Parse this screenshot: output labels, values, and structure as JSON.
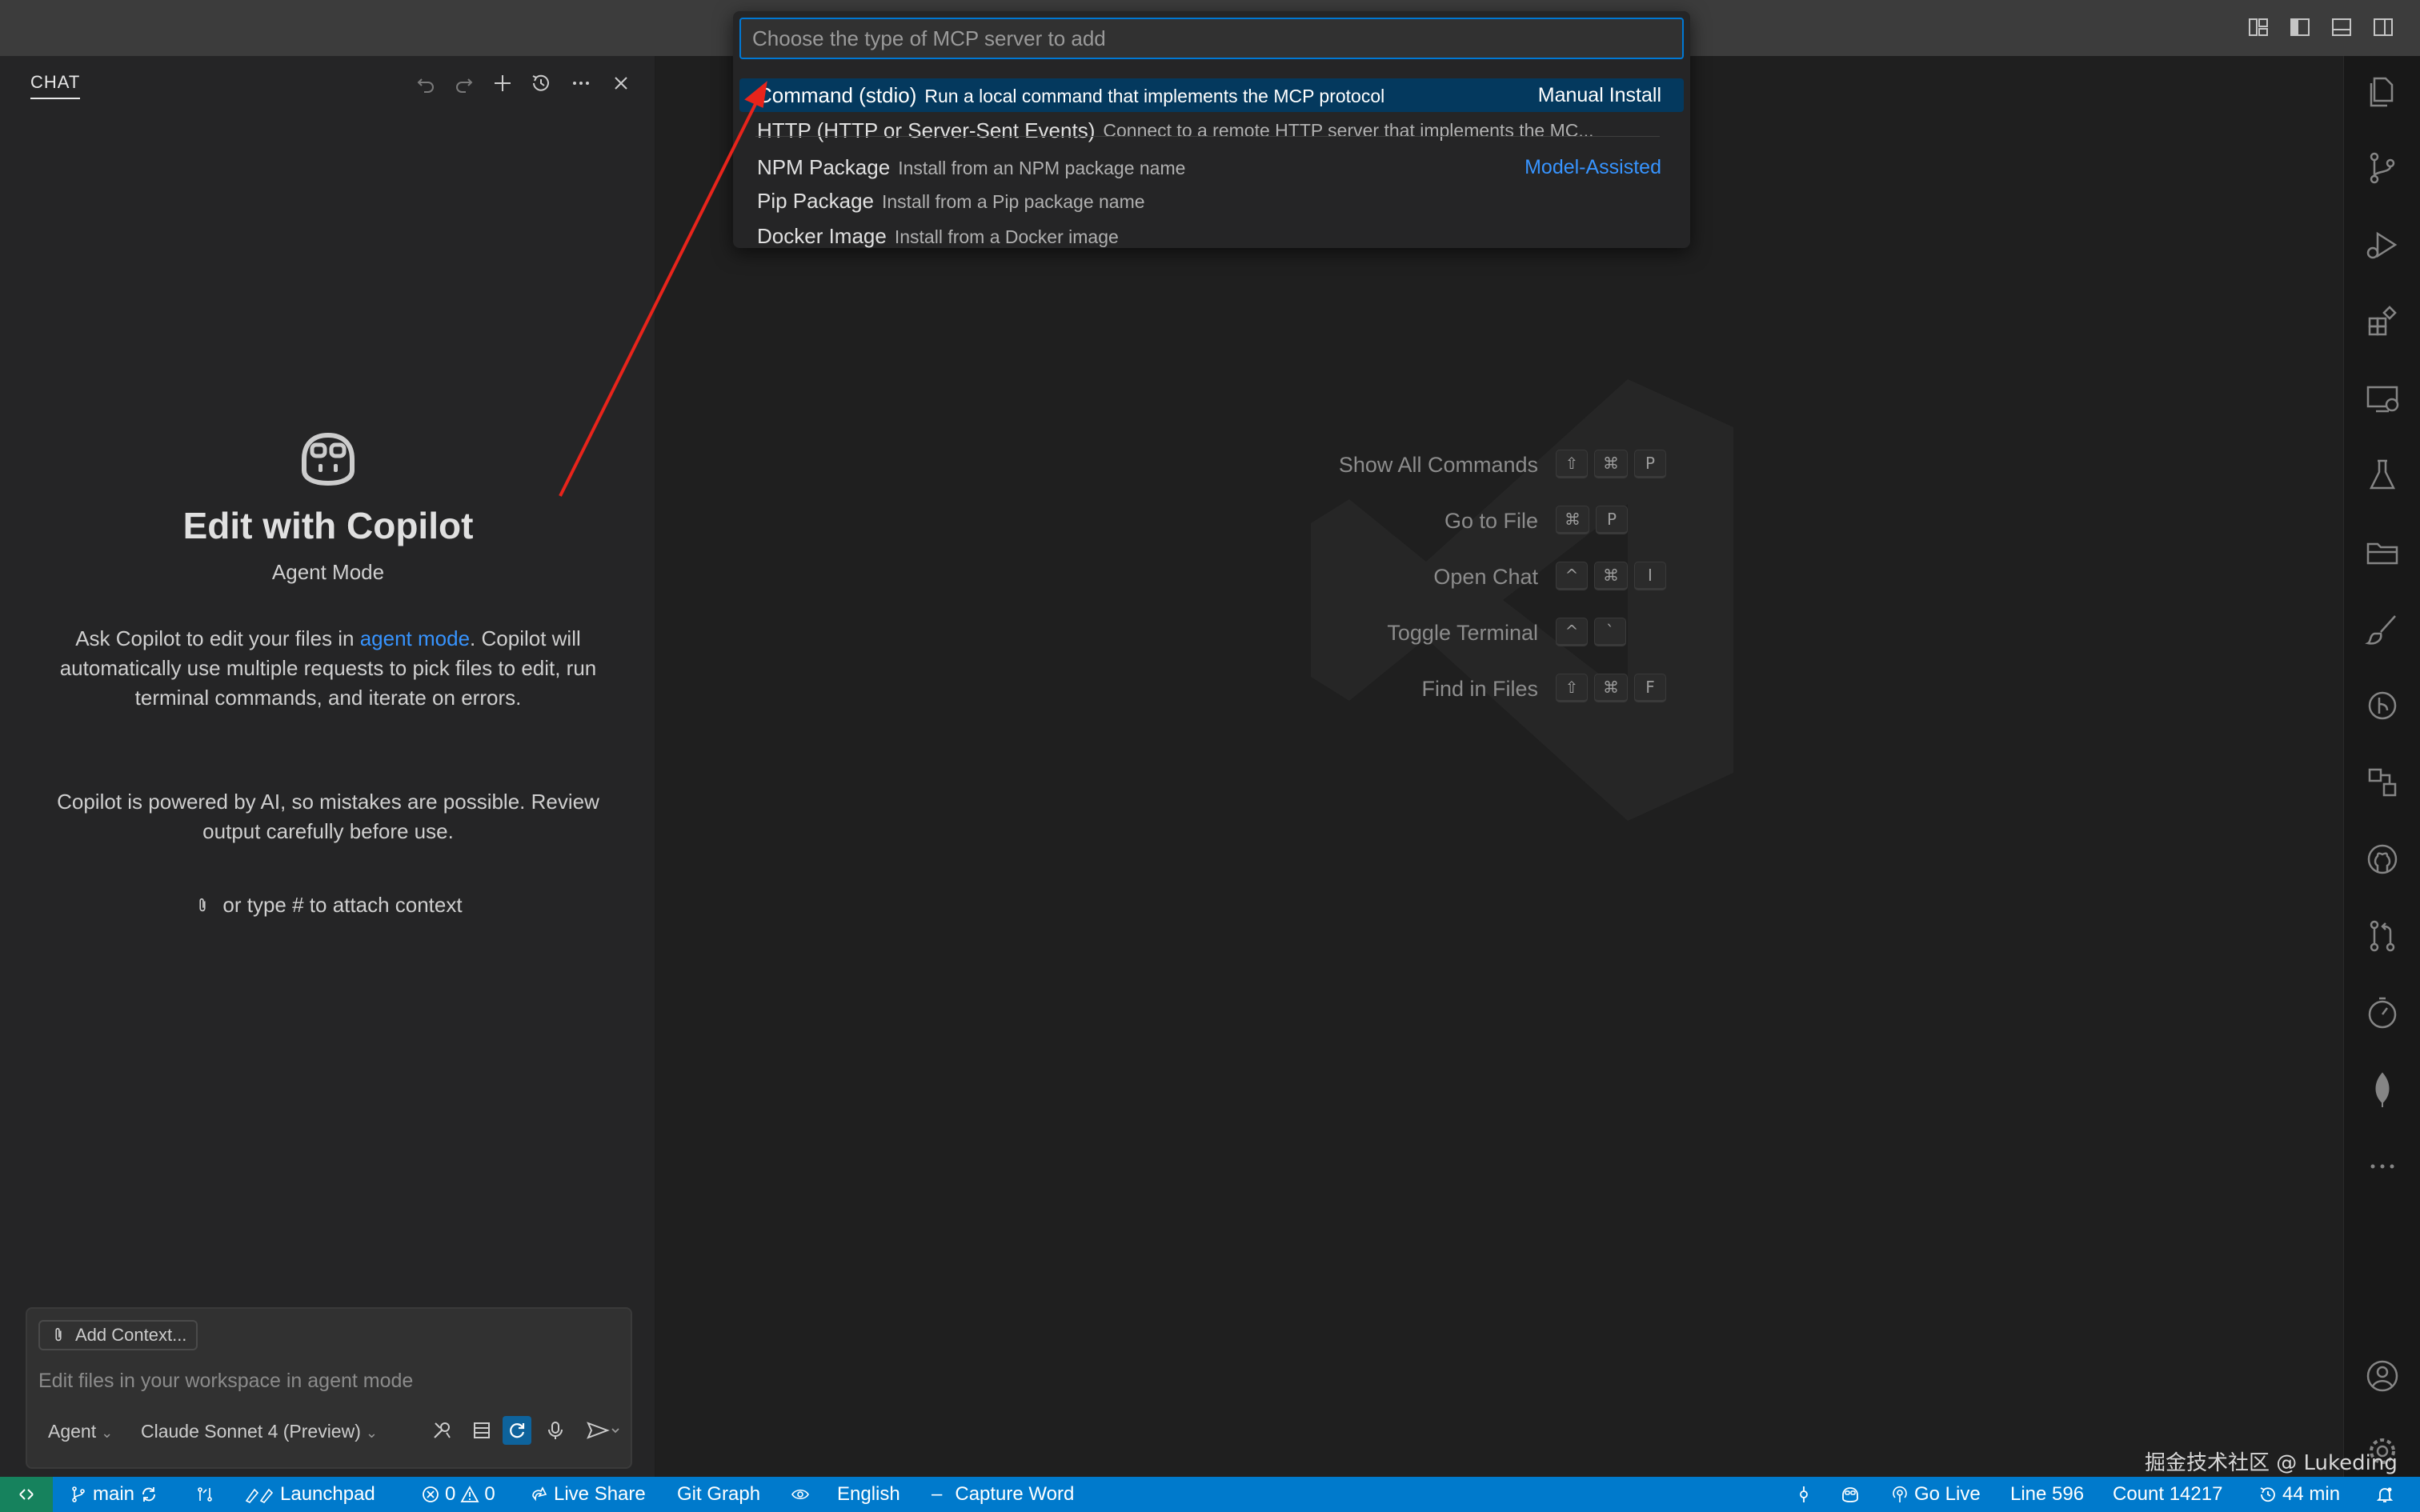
{
  "chat": {
    "tab_label": "CHAT",
    "title": "Edit with Copilot",
    "mode": "Agent Mode",
    "desc1_pre": "Ask Copilot to edit your files in ",
    "desc1_link": "agent mode",
    "desc1_post": ". Copilot will automatically use multiple requests to pick files to edit, run terminal commands, and iterate on errors.",
    "desc2": "Copilot is powered by AI, so mistakes are possible. Review output carefully before use.",
    "attach_hint": "or type # to attach context",
    "add_context_label": "Add Context...",
    "input_placeholder": "Edit files in your workspace in agent mode",
    "agent_label": "Agent",
    "model_label": "Claude Sonnet 4 (Preview)"
  },
  "quickpick": {
    "placeholder": "Choose the type of MCP server to add",
    "items": [
      {
        "name": "Command (stdio)",
        "desc": "Run a local command that implements the MCP protocol",
        "tag": "Manual Install"
      },
      {
        "name": "HTTP (HTTP or Server-Sent Events)",
        "desc": "Connect to a remote HTTP server that implements the MC...",
        "tag": ""
      },
      {
        "name": "NPM Package",
        "desc": "Install from an NPM package name",
        "tag": "Model-Assisted"
      },
      {
        "name": "Pip Package",
        "desc": "Install from a Pip package name",
        "tag": ""
      },
      {
        "name": "Docker Image",
        "desc": "Install from a Docker image",
        "tag": ""
      }
    ]
  },
  "shortcuts": [
    {
      "label": "Show All Commands",
      "keys": [
        "⇧",
        "⌘",
        "P"
      ]
    },
    {
      "label": "Go to File",
      "keys": [
        "⌘",
        "P"
      ]
    },
    {
      "label": "Open Chat",
      "keys": [
        "^",
        "⌘",
        "I"
      ]
    },
    {
      "label": "Toggle Terminal",
      "keys": [
        "^",
        "`"
      ]
    },
    {
      "label": "Find in Files",
      "keys": [
        "⇧",
        "⌘",
        "F"
      ]
    }
  ],
  "statusbar": {
    "branch": "main",
    "launchpad": "Launchpad",
    "errors": "0",
    "warnings": "0",
    "live_share": "Live Share",
    "git_graph": "Git Graph",
    "language": "English",
    "capture_word": "Capture Word",
    "go_live": "Go Live",
    "line": "Line 596",
    "count": "Count 14217",
    "time": "44 min"
  },
  "watermark": "掘金技术社区 @ Lukeding",
  "colors": {
    "accent": "#007acc",
    "link": "#3794ff",
    "selection": "#04395e",
    "remote": "#16825d",
    "arrow": "#e8241b"
  }
}
